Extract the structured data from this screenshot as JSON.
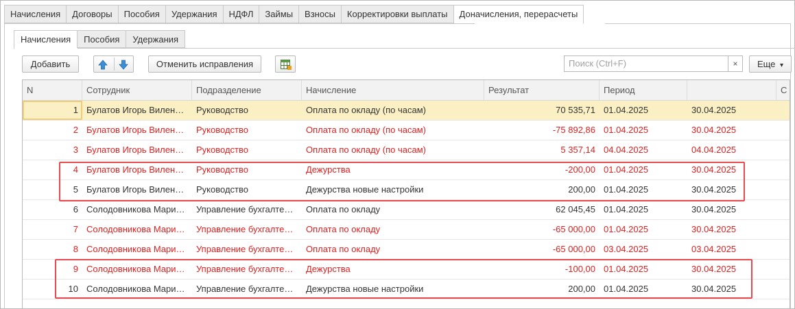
{
  "top_tabs": [
    "Начисления",
    "Договоры",
    "Пособия",
    "Удержания",
    "НДФЛ",
    "Займы",
    "Взносы",
    "Корректировки выплаты",
    "Доначисления, перерасчеты"
  ],
  "sub_tabs": [
    "Начисления",
    "Пособия",
    "Удержания"
  ],
  "toolbar": {
    "add_label": "Добавить",
    "cancel_fix_label": "Отменить исправления",
    "search_placeholder": "Поиск (Ctrl+F)",
    "clear_label": "×",
    "more_label": "Еще",
    "more_caret": "▾"
  },
  "table": {
    "headers": [
      "N",
      "Сотрудник",
      "Подразделение",
      "Начисление",
      "Результат",
      "Период",
      "",
      "С"
    ],
    "rows": [
      {
        "n": "1",
        "emp": "Булатов Игорь Вилен…",
        "dept": "Руководство",
        "acc": "Оплата по окладу (по часам)",
        "res": "70 535,71",
        "from": "01.04.2025",
        "to": "30.04.2025"
      },
      {
        "n": "2",
        "emp": "Булатов Игорь Вилен…",
        "dept": "Руководство",
        "acc": "Оплата по окладу (по часам)",
        "res": "-75 892,86",
        "from": "01.04.2025",
        "to": "30.04.2025"
      },
      {
        "n": "3",
        "emp": "Булатов Игорь Вилен…",
        "dept": "Руководство",
        "acc": "Оплата по окладу (по часам)",
        "res": "5 357,14",
        "from": "04.04.2025",
        "to": "04.04.2025"
      },
      {
        "n": "4",
        "emp": "Булатов Игорь Вилен…",
        "dept": "Руководство",
        "acc": "Дежурства",
        "res": "-200,00",
        "from": "01.04.2025",
        "to": "30.04.2025"
      },
      {
        "n": "5",
        "emp": "Булатов Игорь Вилен…",
        "dept": "Руководство",
        "acc": "Дежурства новые настройки",
        "res": "200,00",
        "from": "01.04.2025",
        "to": "30.04.2025"
      },
      {
        "n": "6",
        "emp": "Солодовникова Мари…",
        "dept": "Управление бухгалте…",
        "acc": "Оплата по окладу",
        "res": "62 045,45",
        "from": "01.04.2025",
        "to": "30.04.2025"
      },
      {
        "n": "7",
        "emp": "Солодовникова Мари…",
        "dept": "Управление бухгалте…",
        "acc": "Оплата по окладу",
        "res": "-65 000,00",
        "from": "01.04.2025",
        "to": "30.04.2025"
      },
      {
        "n": "8",
        "emp": "Солодовникова Мари…",
        "dept": "Управление бухгалте…",
        "acc": "Оплата по окладу",
        "res": "-65 000,00",
        "from": "03.04.2025",
        "to": "03.04.2025"
      },
      {
        "n": "9",
        "emp": "Солодовникова Мари…",
        "dept": "Управление бухгалте…",
        "acc": "Дежурства",
        "res": "-100,00",
        "from": "01.04.2025",
        "to": "30.04.2025"
      },
      {
        "n": "10",
        "emp": "Солодовникова Мари…",
        "dept": "Управление бухгалте…",
        "acc": "Дежурства новые настройки",
        "res": "200,00",
        "from": "01.04.2025",
        "to": "30.04.2025"
      }
    ]
  },
  "colors": {
    "red": "#e02020",
    "text": "#333333",
    "highlight": "#e8484f",
    "selected_row": "#fbf0c4"
  }
}
